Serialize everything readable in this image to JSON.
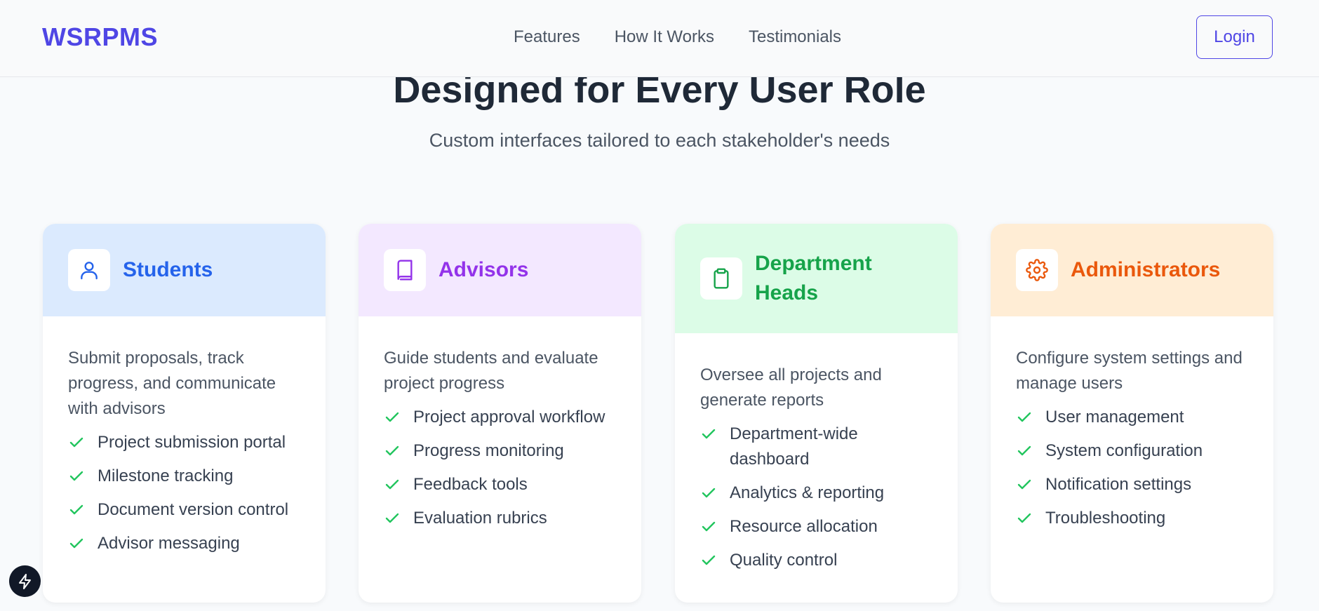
{
  "nav": {
    "brand": "WSRPMS",
    "links": [
      "Features",
      "How It Works",
      "Testimonials"
    ],
    "login_label": "Login"
  },
  "hero": {
    "title": "Designed for Every User Role",
    "subtitle": "Custom interfaces tailored to each stakeholder's needs"
  },
  "roles": [
    {
      "title": "Students",
      "icon": "user-icon",
      "accent": "#2563eb",
      "header_bg": "#dbeafe",
      "description": "Submit proposals, track progress, and communicate with advisors",
      "features": [
        "Project submission portal",
        "Milestone tracking",
        "Document version control",
        "Advisor messaging"
      ]
    },
    {
      "title": "Advisors",
      "icon": "book-icon",
      "accent": "#9333ea",
      "header_bg": "#f3e8ff",
      "description": "Guide students and evaluate project progress",
      "features": [
        "Project approval workflow",
        "Progress monitoring",
        "Feedback tools",
        "Evaluation rubrics"
      ]
    },
    {
      "title": "Department Heads",
      "icon": "clipboard-icon",
      "accent": "#16a34a",
      "header_bg": "#dcfce7",
      "description": "Oversee all projects and generate reports",
      "features": [
        "Department-wide dashboard",
        "Analytics & reporting",
        "Resource allocation",
        "Quality control"
      ]
    },
    {
      "title": "Administrators",
      "icon": "gear-icon",
      "accent": "#ea580c",
      "header_bg": "#ffedd5",
      "description": "Configure system settings and manage users",
      "features": [
        "User management",
        "System configuration",
        "Notification settings",
        "Troubleshooting"
      ]
    }
  ],
  "colors": {
    "brand": "#4f46e5",
    "check": "#22c55e"
  },
  "floating_button_icon": "lightning-icon"
}
